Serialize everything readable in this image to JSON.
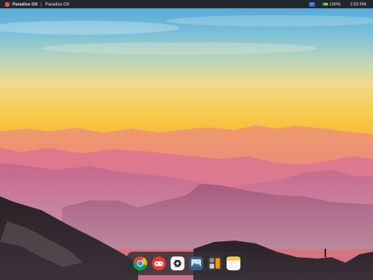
{
  "menubar": {
    "logo_icon": "paradise-logo-icon",
    "app_name": "Paradise OS",
    "active_window": "Paradise OS",
    "user_badge": "JH",
    "battery": "100%",
    "clock": "2:53 PM"
  },
  "wallpaper": {
    "description_icon": "mountain-sunset-wallpaper"
  },
  "dock": {
    "items": [
      {
        "name": "chrome",
        "icon": "chrome-icon"
      },
      {
        "name": "game",
        "icon": "gamepad-icon"
      },
      {
        "name": "chatgpt",
        "icon": "chatgpt-icon"
      },
      {
        "name": "photos",
        "icon": "photos-icon"
      },
      {
        "name": "calculator",
        "icon": "calculator-icon"
      },
      {
        "name": "notes",
        "icon": "notes-icon"
      }
    ]
  }
}
